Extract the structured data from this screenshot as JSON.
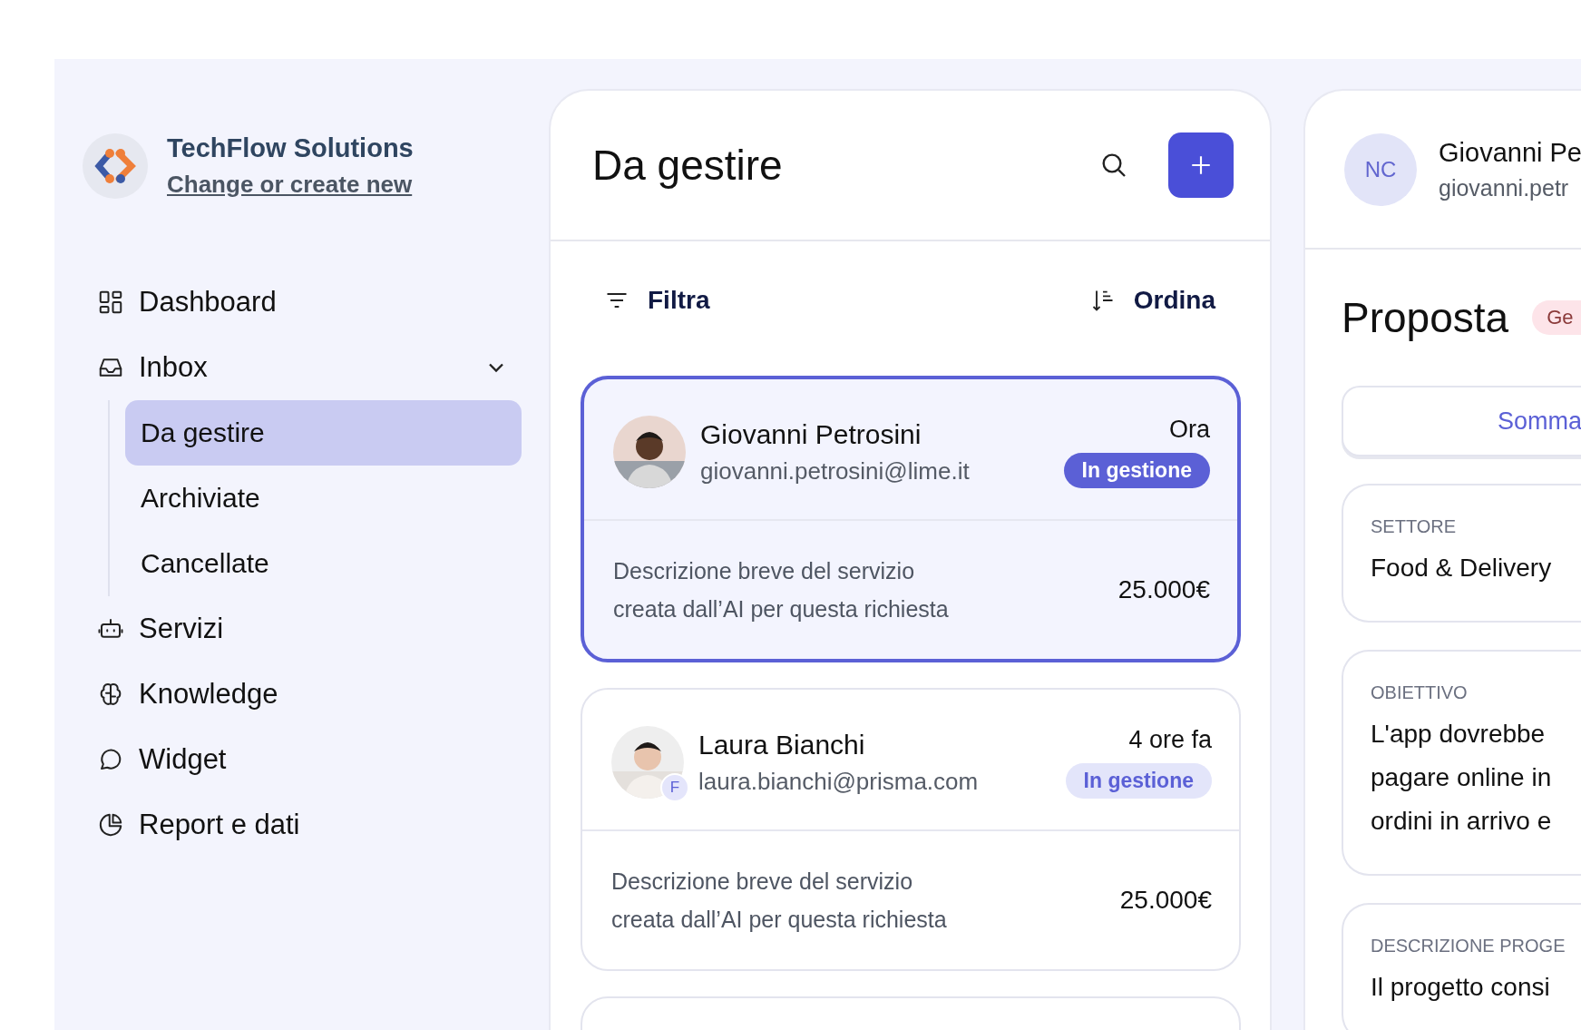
{
  "workspace": {
    "name": "TechFlow Solutions",
    "link": "Change or create new"
  },
  "sidebar": {
    "items": [
      {
        "label": "Dashboard",
        "selected": false
      },
      {
        "label": "Inbox",
        "selected": false,
        "expanded": true,
        "children": [
          {
            "label": "Da gestire",
            "selected": true
          },
          {
            "label": "Archiviate",
            "selected": false
          },
          {
            "label": "Cancellate",
            "selected": false
          }
        ]
      },
      {
        "label": "Servizi",
        "selected": false
      },
      {
        "label": "Knowledge",
        "selected": false
      },
      {
        "label": "Widget",
        "selected": false
      },
      {
        "label": "Report e dati",
        "selected": false
      }
    ]
  },
  "list": {
    "title": "Da gestire",
    "filter": "Filtra",
    "sort": "Ordina",
    "requests": [
      {
        "name": "Giovanni Petrosini",
        "email": "giovanni.petrosini@lime.it",
        "time": "Ora",
        "status": "In gestione",
        "description": "Descrizione breve del servizio creata dall’AI per questa richiesta",
        "amount": "25.000€",
        "selected": true
      },
      {
        "name": "Laura Bianchi",
        "email": "laura.bianchi@prisma.com",
        "time": "4 ore fa",
        "status": "In gestione",
        "description": "Descrizione breve del servizio creata dall’AI per questa richiesta",
        "amount": "25.000€",
        "selected": false,
        "badge": "F"
      },
      {
        "selected": false
      }
    ]
  },
  "detail": {
    "initials": "NC",
    "name": "Giovanni Pe",
    "email": "giovanni.petr",
    "title": "Proposta",
    "tag": "Ge",
    "tab": "Somma",
    "fields": [
      {
        "label": "SETTORE",
        "lines": [
          "Food & Delivery"
        ]
      },
      {
        "label": "OBIETTIVO",
        "lines": [
          "L'app dovrebbe",
          "pagare online in",
          "ordini in arrivo e"
        ]
      },
      {
        "label": "DESCRIZIONE PROGE",
        "lines": [
          "Il progetto consi"
        ]
      }
    ]
  }
}
